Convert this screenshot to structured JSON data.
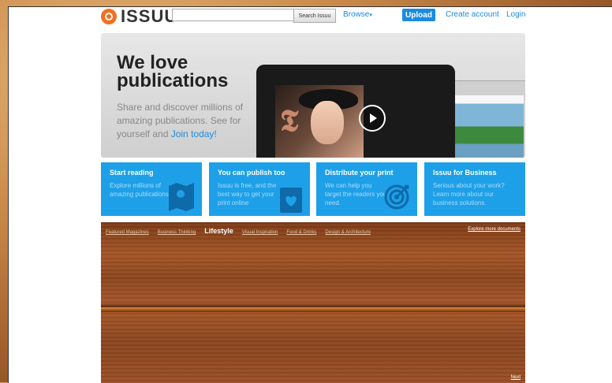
{
  "header": {
    "logo_text": "ISSUU",
    "search_placeholder": "",
    "search_button": "Search Issuu",
    "browse": "Browse",
    "upload": "Upload",
    "create_account": "Create account",
    "login": "Login"
  },
  "hero": {
    "title_line1": "We love",
    "title_line2": "publications",
    "subtitle": "Share and discover millions of amazing publications. See for yourself and ",
    "join_link": "Join today!"
  },
  "cards": [
    {
      "title": "Start reading",
      "desc": "Explore millions of amazing publications",
      "icon": "map-icon"
    },
    {
      "title": "You can publish too",
      "desc": "Issuu is free, and the best way to get your print online",
      "icon": "publication-heart-icon"
    },
    {
      "title": "Distribute your print",
      "desc": "We can help you target the readers you need.",
      "icon": "target-icon"
    },
    {
      "title": "Issuu for Business",
      "desc": "Serious about your work? Learn more about our business solutions.",
      "icon": ""
    }
  ],
  "shelf": {
    "tabs": [
      "Featured Magazines",
      "Business Thinking",
      "Lifestyle",
      "Visual Inspiration",
      "Food & Drinks",
      "Design & Architecture"
    ],
    "active_tab": "Lifestyle",
    "explore_more": "Explore more documents",
    "next": "Next"
  },
  "colors": {
    "brand_blue": "#1a8be0",
    "card_blue": "#1ea0e8",
    "logo_orange": "#f36f21"
  }
}
